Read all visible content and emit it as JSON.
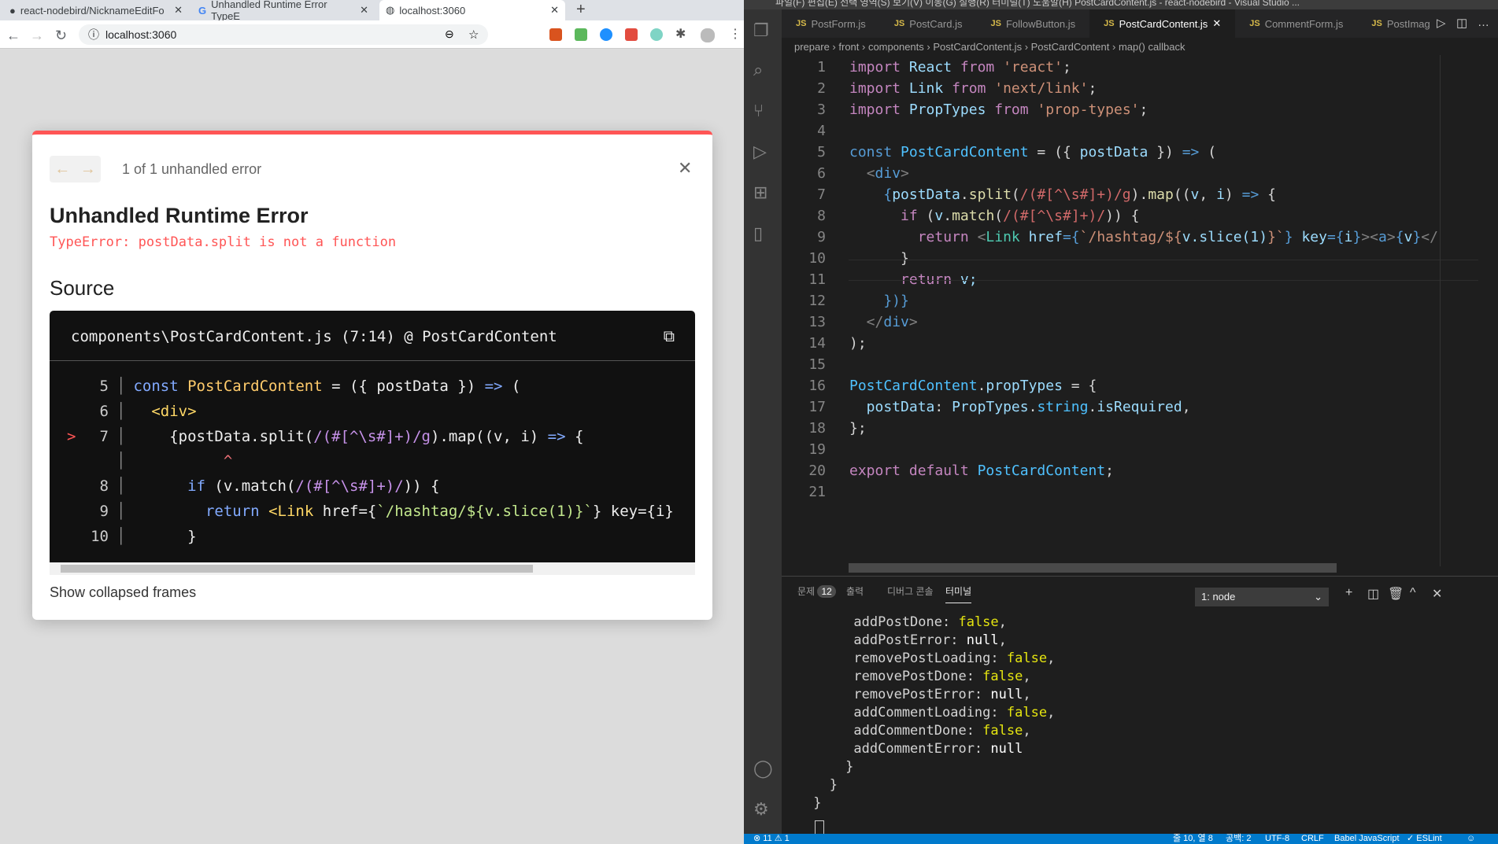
{
  "browser": {
    "tabs": [
      {
        "label": "react-nodebird/NicknameEditFo",
        "icon": "github-icon"
      },
      {
        "label": "Unhandled Runtime Error TypeE",
        "icon": "google-icon"
      },
      {
        "label": "localhost:3060",
        "icon": "globe-icon"
      }
    ],
    "url": "localhost:3060"
  },
  "overlay": {
    "counter": "1 of 1 unhandled error",
    "title": "Unhandled Runtime Error",
    "message": "TypeError: postData.split is not a function",
    "source_heading": "Source",
    "source_file": "components\\PostCardContent.js (7:14) @ PostCardContent",
    "caret": "^",
    "marker": ">",
    "lines": [
      {
        "n": "5",
        "seg": [
          [
            "const ",
            "ek"
          ],
          [
            "PostCardContent",
            "ef"
          ],
          [
            " = ({ postData }) ",
            "ep"
          ],
          [
            "=>",
            "ek"
          ],
          [
            " (",
            "ep"
          ]
        ]
      },
      {
        "n": "6",
        "seg": [
          [
            "  ",
            "ep"
          ],
          [
            "<div>",
            "ew"
          ]
        ]
      },
      {
        "n": "7",
        "seg": [
          [
            "    {postData.split(",
            "ep"
          ],
          [
            "/(#[^\\s#]+)/g",
            "er"
          ],
          [
            ").map((v, i) ",
            "ep"
          ],
          [
            "=>",
            "ek"
          ],
          [
            " {",
            "ep"
          ]
        ]
      },
      {
        "n": "",
        "seg": [
          [
            "          ^",
            "et"
          ]
        ]
      },
      {
        "n": "8",
        "seg": [
          [
            "      ",
            "ep"
          ],
          [
            "if",
            "ek"
          ],
          [
            " (v.match(",
            "ep"
          ],
          [
            "/(#[^\\s#]+)/",
            "er"
          ],
          [
            ")) {",
            "ep"
          ]
        ]
      },
      {
        "n": "9",
        "seg": [
          [
            "        ",
            "ep"
          ],
          [
            "return",
            "ek"
          ],
          [
            " ",
            "ep"
          ],
          [
            "<Link",
            "ew"
          ],
          [
            " href={",
            "ep"
          ],
          [
            "`/hashtag/${v.slice(1)}`",
            "eg"
          ],
          [
            "} key={i}",
            "ep"
          ]
        ]
      },
      {
        "n": "10",
        "seg": [
          [
            "      }",
            "ep"
          ]
        ]
      }
    ],
    "show_collapsed": "Show collapsed frames"
  },
  "vscode": {
    "menu": "파일(F)  편집(E)  선택 영역(S)  보기(V)  이동(G)  실행(R)  터미널(T)  도움말(H)   PostCardContent.js - react-nodebird - Visual Studio ...",
    "tabs": [
      {
        "label": "PostForm.js"
      },
      {
        "label": "PostCard.js"
      },
      {
        "label": "FollowButton.js"
      },
      {
        "label": "PostCardContent.js",
        "active": true
      },
      {
        "label": "CommentForm.js"
      },
      {
        "label": "PostImag"
      }
    ],
    "breadcrumb": [
      "prepare",
      "front",
      "components",
      "PostCardContent.js",
      "PostCardContent",
      "map() callback"
    ],
    "code": [
      [
        [
          "import",
          "kw"
        ],
        [
          " React ",
          "id"
        ],
        [
          "from",
          "kw"
        ],
        [
          " 'react'",
          "s"
        ],
        [
          ";",
          "p"
        ]
      ],
      [
        [
          "import",
          "kw"
        ],
        [
          " Link ",
          "id"
        ],
        [
          "from",
          "kw"
        ],
        [
          " 'next/link'",
          "s"
        ],
        [
          ";",
          "p"
        ]
      ],
      [
        [
          "import",
          "kw"
        ],
        [
          " PropTypes ",
          "id"
        ],
        [
          "from",
          "kw"
        ],
        [
          " 'prop-types'",
          "s"
        ],
        [
          ";",
          "p"
        ]
      ],
      [],
      [
        [
          "const ",
          "st"
        ],
        [
          "PostCardContent",
          "fn"
        ],
        [
          " = ({ ",
          "p"
        ],
        [
          "postData",
          "id"
        ],
        [
          " }) ",
          "p"
        ],
        [
          "=>",
          "st"
        ],
        [
          " (",
          "p"
        ]
      ],
      [
        [
          "  ",
          "p"
        ],
        [
          "<",
          "tg"
        ],
        [
          "div",
          "st"
        ],
        [
          ">",
          "tg"
        ]
      ],
      [
        [
          "    {",
          "st"
        ],
        [
          "postData",
          "id"
        ],
        [
          ".",
          "p"
        ],
        [
          "split",
          "m"
        ],
        [
          "(",
          "p"
        ],
        [
          "/(#[^\\s#]+)/g",
          "re"
        ],
        [
          ").",
          "p"
        ],
        [
          "map",
          "m"
        ],
        [
          "((",
          "p"
        ],
        [
          "v",
          "id"
        ],
        [
          ", ",
          "p"
        ],
        [
          "i",
          "id"
        ],
        [
          ") ",
          "p"
        ],
        [
          "=>",
          "st"
        ],
        [
          " {",
          "p"
        ]
      ],
      [
        [
          "      ",
          "p"
        ],
        [
          "if",
          "kw"
        ],
        [
          " (",
          "p"
        ],
        [
          "v",
          "id"
        ],
        [
          ".",
          "p"
        ],
        [
          "match",
          "m"
        ],
        [
          "(",
          "p"
        ],
        [
          "/(#[^\\s#]+)/",
          "re"
        ],
        [
          ")) {",
          "p"
        ]
      ],
      [
        [
          "        ",
          "p"
        ],
        [
          "return",
          "kw"
        ],
        [
          " <",
          "tg"
        ],
        [
          "Link",
          "ty"
        ],
        [
          " href",
          "id"
        ],
        [
          "={",
          "st"
        ],
        [
          "`/hashtag/${",
          "s"
        ],
        [
          "v.slice(1)",
          "id"
        ],
        [
          "}`",
          "s"
        ],
        [
          "} ",
          "st"
        ],
        [
          "key",
          "id"
        ],
        [
          "={",
          "st"
        ],
        [
          "i",
          "id"
        ],
        [
          "}",
          "st"
        ],
        [
          "><",
          "tg"
        ],
        [
          "a",
          "st"
        ],
        [
          ">",
          "tg"
        ],
        [
          "{",
          "st"
        ],
        [
          "v",
          "id"
        ],
        [
          "}",
          "st"
        ],
        [
          "</",
          "tg"
        ]
      ],
      [
        [
          "      }",
          "p"
        ]
      ],
      [
        [
          "      ",
          "p"
        ],
        [
          "return",
          "kw"
        ],
        [
          " v;",
          "id"
        ]
      ],
      [
        [
          "    })}",
          "st"
        ]
      ],
      [
        [
          "  </",
          "tg"
        ],
        [
          "div",
          "st"
        ],
        [
          ">",
          "tg"
        ]
      ],
      [
        [
          ");",
          "p"
        ]
      ],
      [],
      [
        [
          "PostCardContent",
          "fn"
        ],
        [
          ".",
          "p"
        ],
        [
          "propTypes",
          "id"
        ],
        [
          " = {",
          "p"
        ]
      ],
      [
        [
          "  postData",
          "id"
        ],
        [
          ": ",
          "p"
        ],
        [
          "PropTypes",
          "id"
        ],
        [
          ".",
          "p"
        ],
        [
          "string",
          "fn"
        ],
        [
          ".",
          "p"
        ],
        [
          "isRequired",
          "id"
        ],
        [
          ",",
          "p"
        ]
      ],
      [
        [
          "};",
          "p"
        ]
      ],
      [],
      [
        [
          "export",
          "kw"
        ],
        [
          " ",
          "p"
        ],
        [
          "default",
          "kw"
        ],
        [
          " ",
          "p"
        ],
        [
          "PostCardContent",
          "fn"
        ],
        [
          ";",
          "p"
        ]
      ],
      []
    ],
    "panel": {
      "tabs": [
        "문제",
        "출력",
        "디버그 콘솔",
        "터미널"
      ],
      "problems_count": "12",
      "terminal_select": "1: node"
    },
    "terminal": [
      [
        [
          "      addPostDone: ",
          "p"
        ],
        [
          "false",
          "tf"
        ],
        [
          ",",
          "p"
        ]
      ],
      [
        [
          "      addPostError: ",
          "p"
        ],
        [
          "null",
          "tn"
        ],
        [
          ",",
          "p"
        ]
      ],
      [
        [
          "      removePostLoading: ",
          "p"
        ],
        [
          "false",
          "tf"
        ],
        [
          ",",
          "p"
        ]
      ],
      [
        [
          "      removePostDone: ",
          "p"
        ],
        [
          "false",
          "tf"
        ],
        [
          ",",
          "p"
        ]
      ],
      [
        [
          "      removePostError: ",
          "p"
        ],
        [
          "null",
          "tn"
        ],
        [
          ",",
          "p"
        ]
      ],
      [
        [
          "      addCommentLoading: ",
          "p"
        ],
        [
          "false",
          "tf"
        ],
        [
          ",",
          "p"
        ]
      ],
      [
        [
          "      addCommentDone: ",
          "p"
        ],
        [
          "false",
          "tf"
        ],
        [
          ",",
          "p"
        ]
      ],
      [
        [
          "      addCommentError: ",
          "p"
        ],
        [
          "null",
          "tn"
        ]
      ],
      [
        [
          "     }",
          "p"
        ]
      ],
      [
        [
          "   }",
          "p"
        ]
      ],
      [
        [
          " }",
          "p"
        ]
      ]
    ],
    "status": {
      "errors": "⊗ 11 ⚠ 1",
      "position": "줄 10, 열 8",
      "spaces": "공백: 2",
      "encoding": "UTF-8",
      "eol": "CRLF",
      "language": "Babel JavaScript",
      "linter": "✓ ESLint"
    }
  }
}
